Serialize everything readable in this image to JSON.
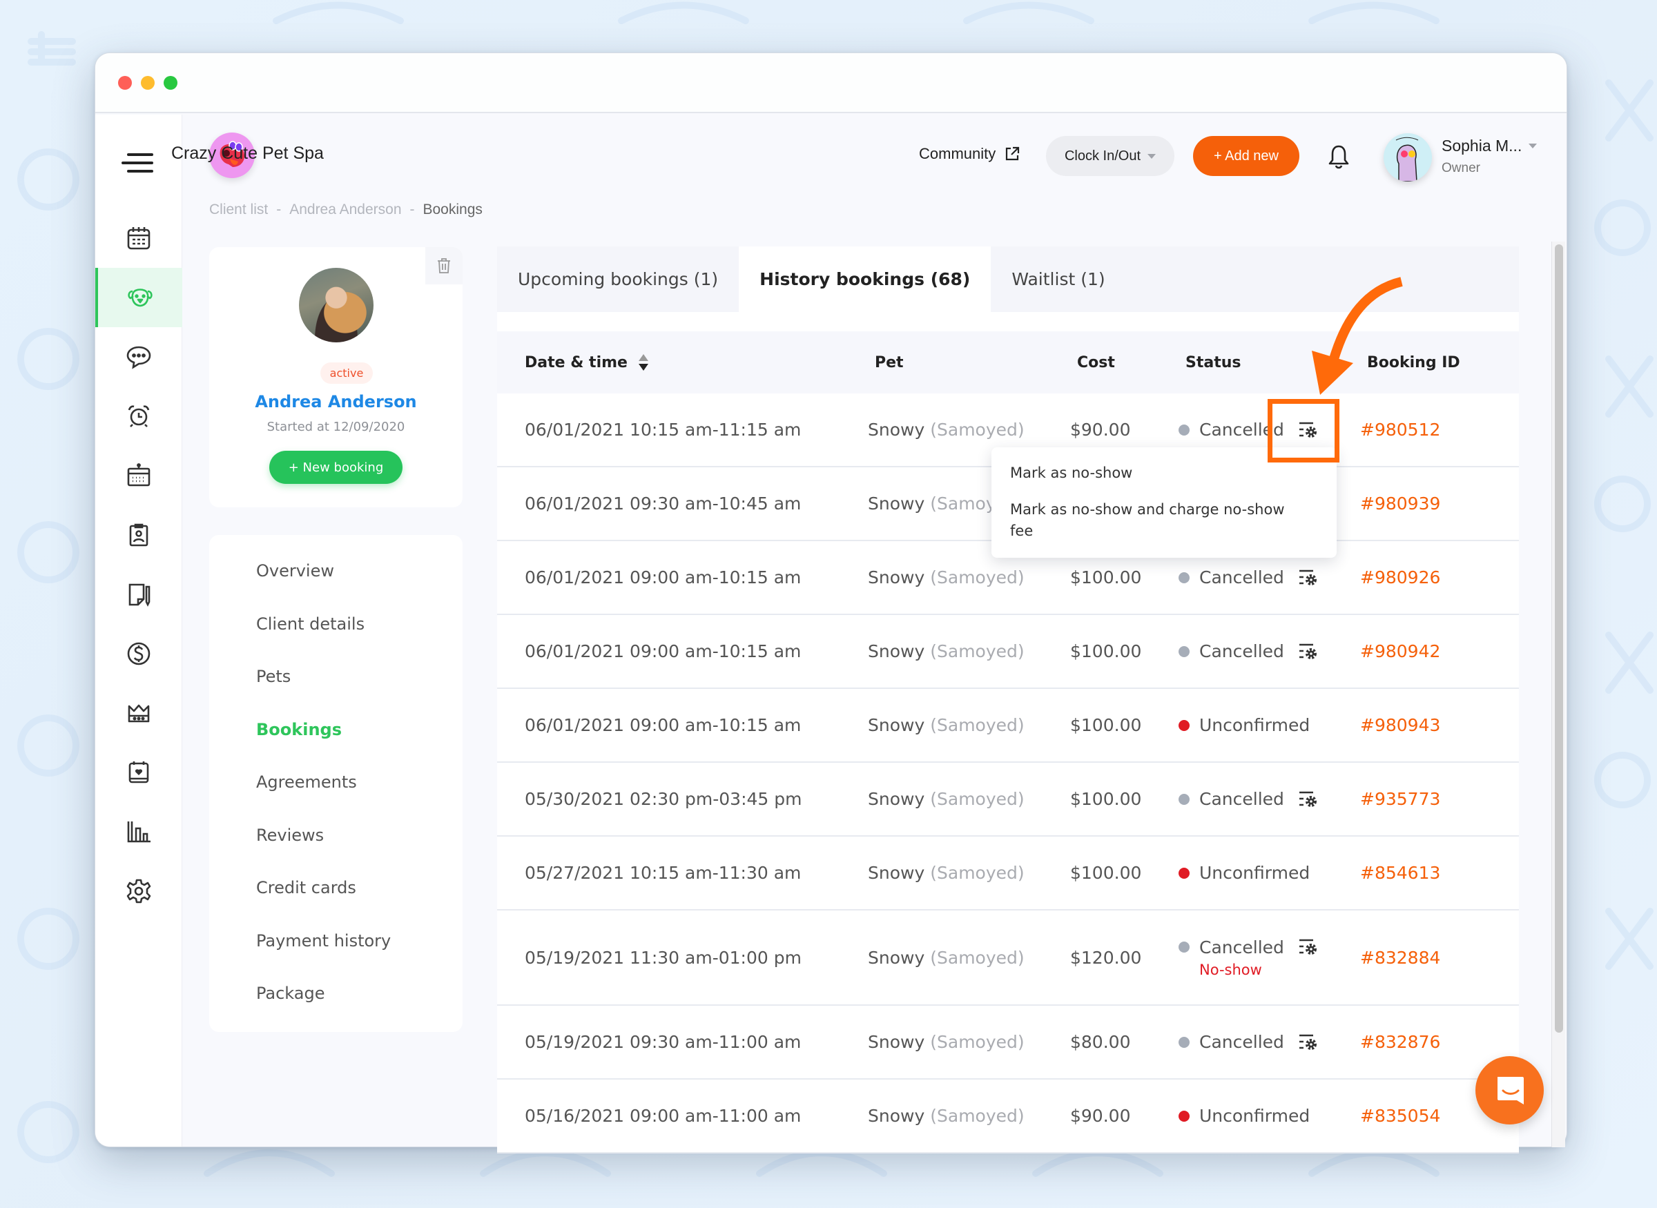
{
  "app": {
    "brand_name": "Crazy Cute Pet Spa",
    "colors": {
      "accent_orange": "#f5600a",
      "accent_green": "#2ec55b",
      "link_blue": "#1e88e5",
      "status_cancelled": "#a6adb8",
      "status_unconfirmed": "#e01b24"
    }
  },
  "window": {
    "controls": [
      "close",
      "minimize",
      "maximize"
    ]
  },
  "rail": {
    "menu_icon": "menu-icon",
    "items": [
      {
        "name": "calendar",
        "icon": "calendar-icon",
        "active": false
      },
      {
        "name": "clients",
        "icon": "dog-icon",
        "active": true
      },
      {
        "name": "messages",
        "icon": "chat-bubble-icon",
        "active": false
      },
      {
        "name": "reminders",
        "icon": "alarm-clock-icon",
        "active": false
      },
      {
        "name": "schedule",
        "icon": "schedule-calendar-icon",
        "active": false
      },
      {
        "name": "staff",
        "icon": "id-badge-icon",
        "active": false
      },
      {
        "name": "notes",
        "icon": "note-pencil-icon",
        "active": false
      },
      {
        "name": "payments",
        "icon": "dollar-icon",
        "active": false
      },
      {
        "name": "memberships",
        "icon": "crown-icon",
        "active": false
      },
      {
        "name": "events",
        "icon": "calendar-heart-icon",
        "active": false
      },
      {
        "name": "reports",
        "icon": "bar-chart-icon",
        "active": false
      },
      {
        "name": "settings",
        "icon": "gear-icon",
        "active": false
      }
    ]
  },
  "header": {
    "community_label": "Community",
    "clock_label": "Clock In/Out",
    "add_new_label": "+ Add new",
    "user_name": "Sophia M...",
    "user_role": "Owner"
  },
  "breadcrumb": {
    "items": [
      "Client list",
      "Andrea Anderson",
      "Bookings"
    ],
    "separator": "-"
  },
  "client": {
    "status": "active",
    "name": "Andrea Anderson",
    "since": "Started at 12/09/2020",
    "new_booking_label": "+ New booking"
  },
  "subnav": {
    "items": [
      {
        "label": "Overview",
        "active": false
      },
      {
        "label": "Client details",
        "active": false
      },
      {
        "label": "Pets",
        "active": false
      },
      {
        "label": "Bookings",
        "active": true
      },
      {
        "label": "Agreements",
        "active": false
      },
      {
        "label": "Reviews",
        "active": false
      },
      {
        "label": "Credit cards",
        "active": false
      },
      {
        "label": "Payment history",
        "active": false
      },
      {
        "label": "Package",
        "active": false
      }
    ]
  },
  "tabs": [
    {
      "label": "Upcoming bookings (1)",
      "active": false
    },
    {
      "label": "History bookings (68)",
      "active": true
    },
    {
      "label": "Waitlist (1)",
      "active": false
    }
  ],
  "table": {
    "columns": [
      "Date & time",
      "Pet",
      "Cost",
      "Status",
      "Booking ID"
    ],
    "rows": [
      {
        "date": "06/01/2021 10:15 am-11:15 am",
        "pet": "Snowy",
        "breed": "(Samoyed)",
        "cost": "$90.00",
        "status": "Cancelled",
        "status_color": "#a6adb8",
        "actions": true,
        "note": "",
        "id": "#980512"
      },
      {
        "date": "06/01/2021 09:30 am-10:45 am",
        "pet": "Snowy",
        "breed": "(Samoyed)",
        "cost": "",
        "status": "",
        "status_color": "",
        "actions": false,
        "note": "",
        "id": "#980939"
      },
      {
        "date": "06/01/2021 09:00 am-10:15 am",
        "pet": "Snowy",
        "breed": "(Samoyed)",
        "cost": "$100.00",
        "status": "Cancelled",
        "status_color": "#a6adb8",
        "actions": true,
        "note": "",
        "id": "#980926"
      },
      {
        "date": "06/01/2021 09:00 am-10:15 am",
        "pet": "Snowy",
        "breed": "(Samoyed)",
        "cost": "$100.00",
        "status": "Cancelled",
        "status_color": "#a6adb8",
        "actions": true,
        "note": "",
        "id": "#980942"
      },
      {
        "date": "06/01/2021 09:00 am-10:15 am",
        "pet": "Snowy",
        "breed": "(Samoyed)",
        "cost": "$100.00",
        "status": "Unconfirmed",
        "status_color": "#e01b24",
        "actions": false,
        "note": "",
        "id": "#980943"
      },
      {
        "date": "05/30/2021 02:30 pm-03:45 pm",
        "pet": "Snowy",
        "breed": "(Samoyed)",
        "cost": "$100.00",
        "status": "Cancelled",
        "status_color": "#a6adb8",
        "actions": true,
        "note": "",
        "id": "#935773"
      },
      {
        "date": "05/27/2021 10:15 am-11:30 am",
        "pet": "Snowy",
        "breed": "(Samoyed)",
        "cost": "$100.00",
        "status": "Unconfirmed",
        "status_color": "#e01b24",
        "actions": false,
        "note": "",
        "id": "#854613"
      },
      {
        "date": "05/19/2021 11:30 am-01:00 pm",
        "pet": "Snowy",
        "breed": "(Samoyed)",
        "cost": "$120.00",
        "status": "Cancelled",
        "status_color": "#a6adb8",
        "actions": true,
        "note": "No-show",
        "id": "#832884"
      },
      {
        "date": "05/19/2021 09:30 am-11:00 am",
        "pet": "Snowy",
        "breed": "(Samoyed)",
        "cost": "$80.00",
        "status": "Cancelled",
        "status_color": "#a6adb8",
        "actions": true,
        "note": "",
        "id": "#832876"
      },
      {
        "date": "05/16/2021 09:00 am-11:00 am",
        "pet": "Snowy",
        "breed": "(Samoyed)",
        "cost": "$90.00",
        "status": "Unconfirmed",
        "status_color": "#e01b24",
        "actions": false,
        "note": "",
        "id": "#835054"
      }
    ]
  },
  "dropdown": {
    "items": [
      "Mark as no-show",
      "Mark as no-show and charge no-show fee"
    ]
  },
  "annotation": {
    "color": "#ff6a0a",
    "target": "booking-actions-gear-row-1"
  }
}
